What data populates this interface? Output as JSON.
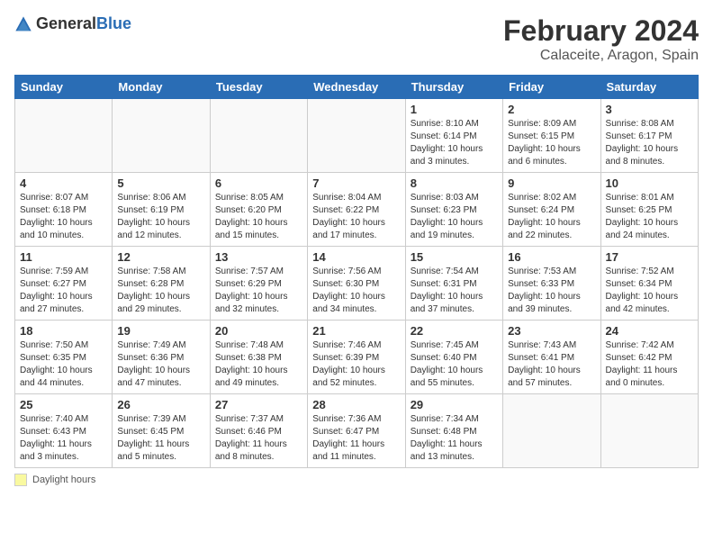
{
  "header": {
    "logo_general": "General",
    "logo_blue": "Blue",
    "month_year": "February 2024",
    "location": "Calaceite, Aragon, Spain"
  },
  "days_of_week": [
    "Sunday",
    "Monday",
    "Tuesday",
    "Wednesday",
    "Thursday",
    "Friday",
    "Saturday"
  ],
  "weeks": [
    [
      {
        "day": "",
        "info": ""
      },
      {
        "day": "",
        "info": ""
      },
      {
        "day": "",
        "info": ""
      },
      {
        "day": "",
        "info": ""
      },
      {
        "day": "1",
        "info": "Sunrise: 8:10 AM\nSunset: 6:14 PM\nDaylight: 10 hours\nand 3 minutes."
      },
      {
        "day": "2",
        "info": "Sunrise: 8:09 AM\nSunset: 6:15 PM\nDaylight: 10 hours\nand 6 minutes."
      },
      {
        "day": "3",
        "info": "Sunrise: 8:08 AM\nSunset: 6:17 PM\nDaylight: 10 hours\nand 8 minutes."
      }
    ],
    [
      {
        "day": "4",
        "info": "Sunrise: 8:07 AM\nSunset: 6:18 PM\nDaylight: 10 hours\nand 10 minutes."
      },
      {
        "day": "5",
        "info": "Sunrise: 8:06 AM\nSunset: 6:19 PM\nDaylight: 10 hours\nand 12 minutes."
      },
      {
        "day": "6",
        "info": "Sunrise: 8:05 AM\nSunset: 6:20 PM\nDaylight: 10 hours\nand 15 minutes."
      },
      {
        "day": "7",
        "info": "Sunrise: 8:04 AM\nSunset: 6:22 PM\nDaylight: 10 hours\nand 17 minutes."
      },
      {
        "day": "8",
        "info": "Sunrise: 8:03 AM\nSunset: 6:23 PM\nDaylight: 10 hours\nand 19 minutes."
      },
      {
        "day": "9",
        "info": "Sunrise: 8:02 AM\nSunset: 6:24 PM\nDaylight: 10 hours\nand 22 minutes."
      },
      {
        "day": "10",
        "info": "Sunrise: 8:01 AM\nSunset: 6:25 PM\nDaylight: 10 hours\nand 24 minutes."
      }
    ],
    [
      {
        "day": "11",
        "info": "Sunrise: 7:59 AM\nSunset: 6:27 PM\nDaylight: 10 hours\nand 27 minutes."
      },
      {
        "day": "12",
        "info": "Sunrise: 7:58 AM\nSunset: 6:28 PM\nDaylight: 10 hours\nand 29 minutes."
      },
      {
        "day": "13",
        "info": "Sunrise: 7:57 AM\nSunset: 6:29 PM\nDaylight: 10 hours\nand 32 minutes."
      },
      {
        "day": "14",
        "info": "Sunrise: 7:56 AM\nSunset: 6:30 PM\nDaylight: 10 hours\nand 34 minutes."
      },
      {
        "day": "15",
        "info": "Sunrise: 7:54 AM\nSunset: 6:31 PM\nDaylight: 10 hours\nand 37 minutes."
      },
      {
        "day": "16",
        "info": "Sunrise: 7:53 AM\nSunset: 6:33 PM\nDaylight: 10 hours\nand 39 minutes."
      },
      {
        "day": "17",
        "info": "Sunrise: 7:52 AM\nSunset: 6:34 PM\nDaylight: 10 hours\nand 42 minutes."
      }
    ],
    [
      {
        "day": "18",
        "info": "Sunrise: 7:50 AM\nSunset: 6:35 PM\nDaylight: 10 hours\nand 44 minutes."
      },
      {
        "day": "19",
        "info": "Sunrise: 7:49 AM\nSunset: 6:36 PM\nDaylight: 10 hours\nand 47 minutes."
      },
      {
        "day": "20",
        "info": "Sunrise: 7:48 AM\nSunset: 6:38 PM\nDaylight: 10 hours\nand 49 minutes."
      },
      {
        "day": "21",
        "info": "Sunrise: 7:46 AM\nSunset: 6:39 PM\nDaylight: 10 hours\nand 52 minutes."
      },
      {
        "day": "22",
        "info": "Sunrise: 7:45 AM\nSunset: 6:40 PM\nDaylight: 10 hours\nand 55 minutes."
      },
      {
        "day": "23",
        "info": "Sunrise: 7:43 AM\nSunset: 6:41 PM\nDaylight: 10 hours\nand 57 minutes."
      },
      {
        "day": "24",
        "info": "Sunrise: 7:42 AM\nSunset: 6:42 PM\nDaylight: 11 hours\nand 0 minutes."
      }
    ],
    [
      {
        "day": "25",
        "info": "Sunrise: 7:40 AM\nSunset: 6:43 PM\nDaylight: 11 hours\nand 3 minutes."
      },
      {
        "day": "26",
        "info": "Sunrise: 7:39 AM\nSunset: 6:45 PM\nDaylight: 11 hours\nand 5 minutes."
      },
      {
        "day": "27",
        "info": "Sunrise: 7:37 AM\nSunset: 6:46 PM\nDaylight: 11 hours\nand 8 minutes."
      },
      {
        "day": "28",
        "info": "Sunrise: 7:36 AM\nSunset: 6:47 PM\nDaylight: 11 hours\nand 11 minutes."
      },
      {
        "day": "29",
        "info": "Sunrise: 7:34 AM\nSunset: 6:48 PM\nDaylight: 11 hours\nand 13 minutes."
      },
      {
        "day": "",
        "info": ""
      },
      {
        "day": "",
        "info": ""
      }
    ]
  ],
  "legend": {
    "label": "Daylight hours"
  }
}
